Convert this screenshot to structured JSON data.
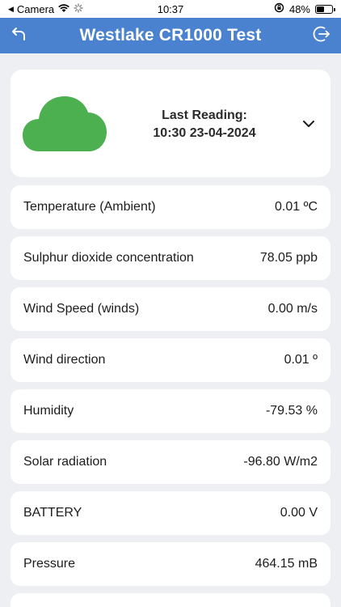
{
  "status_bar": {
    "back_app": "Camera",
    "time": "10:37",
    "battery": "48%",
    "battery_level": 0.48
  },
  "header": {
    "title": "Westlake CR1000 Test",
    "back_icon": "undo-arrow-icon",
    "logout_icon": "logout-icon"
  },
  "summary": {
    "weather_icon": "cloud-icon",
    "cloud_color": "#4caf50",
    "reading_label": "Last Reading:",
    "reading_time": "10:30 23-04-2024",
    "expand_icon": "chevron-down-icon"
  },
  "metrics": [
    {
      "label": "Temperature (Ambient)",
      "value": "0.01 ºC"
    },
    {
      "label": "Sulphur dioxide concentration",
      "value": "78.05 ppb"
    },
    {
      "label": "Wind Speed (winds)",
      "value": "0.00 m/s"
    },
    {
      "label": "Wind direction",
      "value": "0.01 º"
    },
    {
      "label": "Humidity",
      "value": "-79.53 %"
    },
    {
      "label": "Solar radiation",
      "value": "-96.80 W/m2"
    },
    {
      "label": "BATTERY",
      "value": "0.00 V"
    },
    {
      "label": "Pressure",
      "value": "464.15 mB"
    }
  ],
  "colors": {
    "header": "#4a82d0",
    "background": "#eeeff3"
  }
}
